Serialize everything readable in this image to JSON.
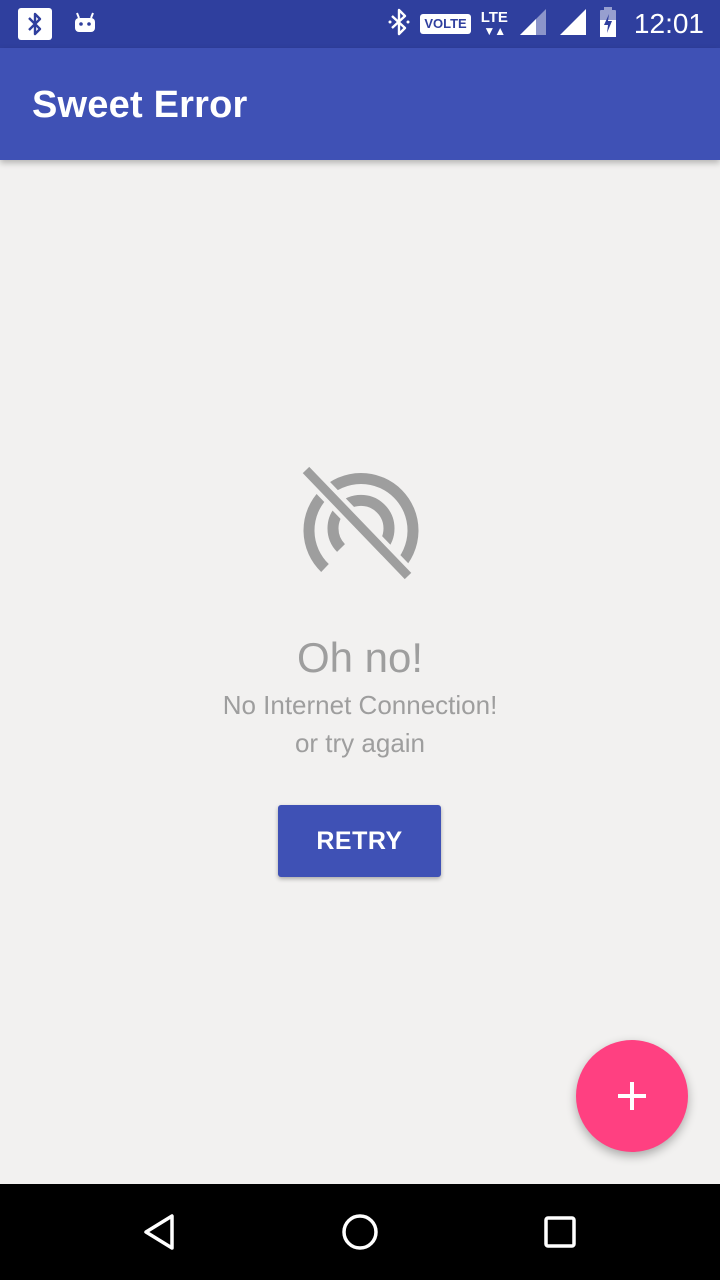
{
  "status_bar": {
    "time": "12:01",
    "volte": "VOLTE",
    "lte": "LTE",
    "icons": [
      "bluetooth-icon",
      "android-icon",
      "bluetooth-icon",
      "signal-icon",
      "signal-icon",
      "battery-charging-icon"
    ]
  },
  "app_bar": {
    "title": "Sweet Error"
  },
  "error": {
    "icon": "no-signal-icon",
    "title": "Oh no!",
    "message": "No Internet Connection!",
    "subtext": "or try again",
    "button_label": "RETRY"
  },
  "fab": {
    "icon": "plus-icon"
  },
  "nav_bar": {
    "icons": [
      "back-icon",
      "home-icon",
      "recents-icon"
    ]
  },
  "colors": {
    "primary": "#3f51b5",
    "primary_dark": "#2f3f9e",
    "accent": "#ff4081",
    "text_gray": "#9e9e9e",
    "background": "#f2f1f0"
  }
}
